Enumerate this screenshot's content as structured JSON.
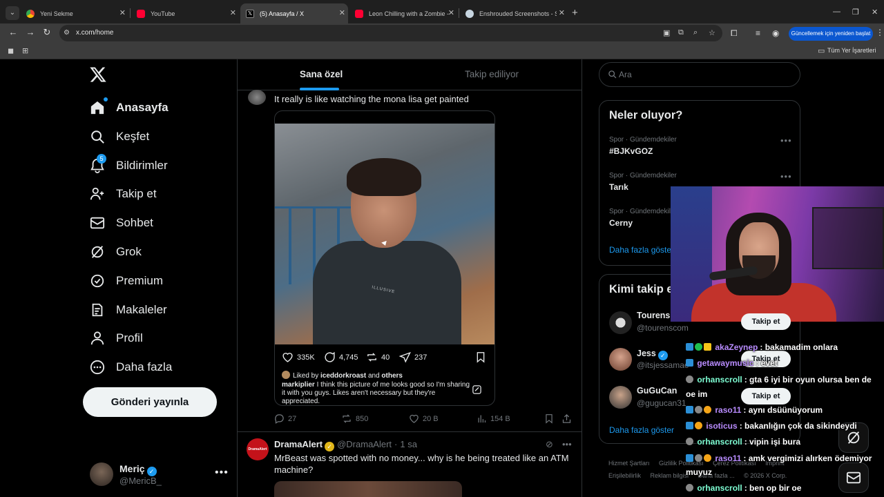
{
  "browser": {
    "tabs": [
      {
        "title": "Yeni Sekme",
        "icon": "chrome-icon"
      },
      {
        "title": "YouTube",
        "icon": "youtube-icon"
      },
      {
        "title": "(5) Anasayfa / X",
        "icon": "x-icon"
      },
      {
        "title": "Leon Chilling with a Zombie - R",
        "icon": "youtube-icon"
      },
      {
        "title": "Enshrouded Screenshots - Steam",
        "icon": "steam-icon"
      }
    ],
    "url": "x.com/home",
    "update_button": "Güncellemek için yeniden başlat",
    "bookmarks_all": "Tüm Yer İşaretleri"
  },
  "nav": {
    "items": [
      {
        "label": "Anasayfa",
        "icon": "home-icon"
      },
      {
        "label": "Keşfet",
        "icon": "search-icon"
      },
      {
        "label": "Bildirimler",
        "icon": "bell-icon",
        "badge": "5"
      },
      {
        "label": "Takip et",
        "icon": "add-person-icon"
      },
      {
        "label": "Sohbet",
        "icon": "mail-icon"
      },
      {
        "label": "Grok",
        "icon": "grok-icon"
      },
      {
        "label": "Premium",
        "icon": "premium-icon"
      },
      {
        "label": "Makaleler",
        "icon": "article-icon"
      },
      {
        "label": "Profil",
        "icon": "person-icon"
      },
      {
        "label": "Daha fazla",
        "icon": "more-circle-icon"
      }
    ],
    "post_button": "Gönderi yayınla",
    "account": {
      "name": "Meriç",
      "handle": "@MericB_"
    }
  },
  "timeline": {
    "tabs": [
      "Sana özel",
      "Takip ediliyor"
    ],
    "tweet1": {
      "text": "It really is like watching the mona lisa get painted",
      "quote": {
        "likes": "335K",
        "comments": "4,745",
        "reposts": "40",
        "shares": "237",
        "liked_by_prefix": "Liked by ",
        "liked_by_user": "iceddorkroast",
        "liked_by_mid": " and ",
        "liked_by_others": "others",
        "caption_user": "markiplier",
        "caption_text": " I think this picture of me looks good so I'm sharing it with you guys. Likes aren't necessary but they're appreciated.",
        "shirt_text": "ILLUSIVE"
      },
      "stats": {
        "replies": "27",
        "reposts": "850",
        "likes": "20 B",
        "views": "154 B"
      }
    },
    "tweet2": {
      "name": "DramaAlert",
      "handle": "@DramaAlert",
      "time": "1 sa",
      "avatar_text": "DramaAlert",
      "text": "MrBeast was spotted with no money... why is he being treated like an ATM machine?"
    }
  },
  "sidebar": {
    "search_placeholder": "Ara",
    "trends_title": "Neler oluyor?",
    "trends": [
      {
        "category": "Spor · Gündemdekiler",
        "name": "#BJKvGOZ"
      },
      {
        "category": "Spor · Gündemdekiler",
        "name": "Tarık"
      },
      {
        "category": "Spor · Gündemdekiler",
        "name": "Cerny"
      }
    ],
    "show_more": "Daha fazla göster",
    "who_title": "Kimi takip et",
    "who": [
      {
        "name": "Tourens",
        "handle": "@tourenscom",
        "button": "Takip et"
      },
      {
        "name": "Jess",
        "handle": "@itsjessamae",
        "button": "Takip et"
      },
      {
        "name": "GuGuCan",
        "handle": "@gugucan31",
        "button": "Takip et"
      }
    ],
    "who_show_more": "Daha fazla göster",
    "footer": [
      "Hizmet Şartları",
      "Gizlilik Politikası",
      "Çerez Politikası",
      "Imprint",
      "Erişilebilirlik",
      "Reklam bilgisi",
      "Daha fazla ...",
      "© 2026 X Corp."
    ]
  },
  "chat": [
    {
      "user": "akaZeynep",
      "msg": ": bakamadim onlara",
      "color": "#b98cff"
    },
    {
      "user": "getawaymusic",
      "msg": ": evet",
      "color": "#b98cff"
    },
    {
      "user": "orhanscroll",
      "msg": ": gta 6 iyi bir oyun olursa ben de",
      "color": "#7fffd4"
    },
    {
      "user": "",
      "msg": "oe im",
      "color": "#ffffff"
    },
    {
      "user": "raso11",
      "msg": ": aynı dsüünüyorum",
      "color": "#b98cff"
    },
    {
      "user": "isoticus",
      "msg": ": bakanlığın çok da sikindeydi",
      "color": "#b98cff"
    },
    {
      "user": "orhanscroll",
      "msg": ": vipin işi bura",
      "color": "#7fffd4"
    },
    {
      "user": "raso11",
      "msg": ": amk vergimizi alırken ödemiyor",
      "color": "#b98cff"
    },
    {
      "user": "",
      "msg": "muyuz",
      "color": "#ffffff"
    },
    {
      "user": "orhanscroll",
      "msg": ": ben op bir oe",
      "color": "#7fffd4"
    }
  ],
  "colors": {
    "accent": "#1d9bf0",
    "background": "#000000",
    "text": "#e7e9ea",
    "muted": "#71767b",
    "border": "#2f3336"
  }
}
